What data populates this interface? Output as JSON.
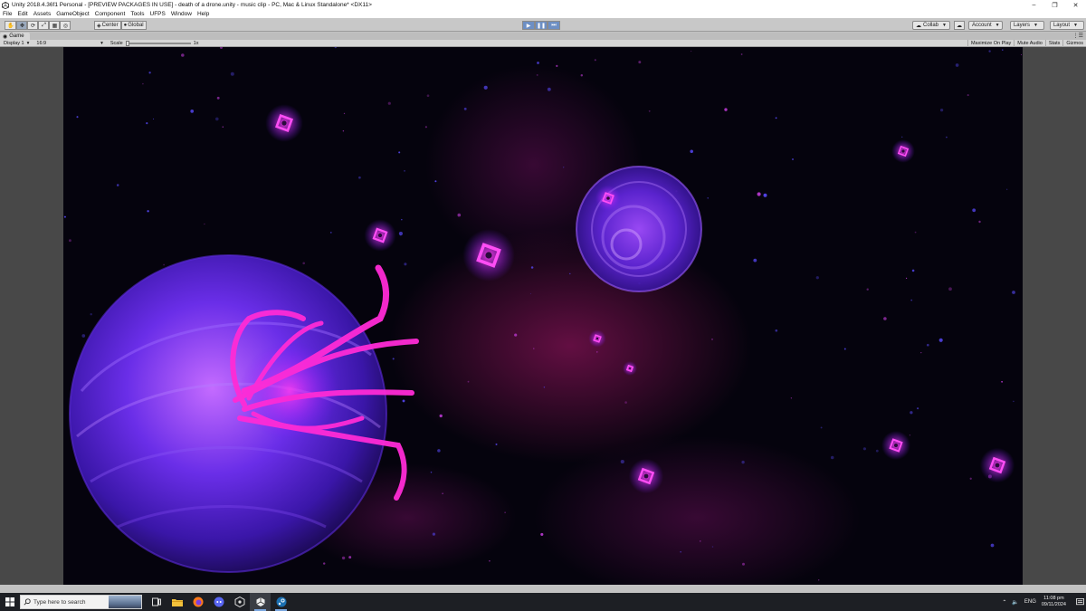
{
  "window": {
    "title": "Unity 2018.4.36f1 Personal - [PREVIEW PACKAGES IN USE] - death of a drone.unity - music clip - PC, Mac & Linux Standalone* <DX11>",
    "controls": [
      "minimize-icon",
      "restore-icon",
      "close-icon"
    ]
  },
  "menu": [
    "File",
    "Edit",
    "Assets",
    "GameObject",
    "Component",
    "Tools",
    "UFPS",
    "Window",
    "Help"
  ],
  "toolbar": {
    "pivot_label": "Center",
    "space_label": "Global",
    "collab_label": "Collab",
    "account_label": "Account",
    "layers_label": "Layers",
    "layout_label": "Layout",
    "play_state": "playing"
  },
  "game_tab": {
    "label": "Game",
    "display": "Display 1",
    "aspect": "16:9",
    "scale_label": "Scale",
    "scale_value": "1x",
    "buttons": [
      "Maximize On Play",
      "Mute Audio",
      "Stats",
      "Gizmos"
    ]
  },
  "taskbar": {
    "search_placeholder": "Type here to search",
    "pinned": [
      "task-view-icon",
      "file-explorer-icon",
      "firefox-icon",
      "discord-icon",
      "unity-hub-icon",
      "unity-editor-icon",
      "steam-icon"
    ],
    "language": "ENG",
    "time": "11:08 pm",
    "date": "09/11/2024"
  },
  "colors": {
    "accent": "#6d8fc4",
    "nebula": "#ff2bd6",
    "planet": "#7b2fff",
    "space": "#05030d"
  }
}
